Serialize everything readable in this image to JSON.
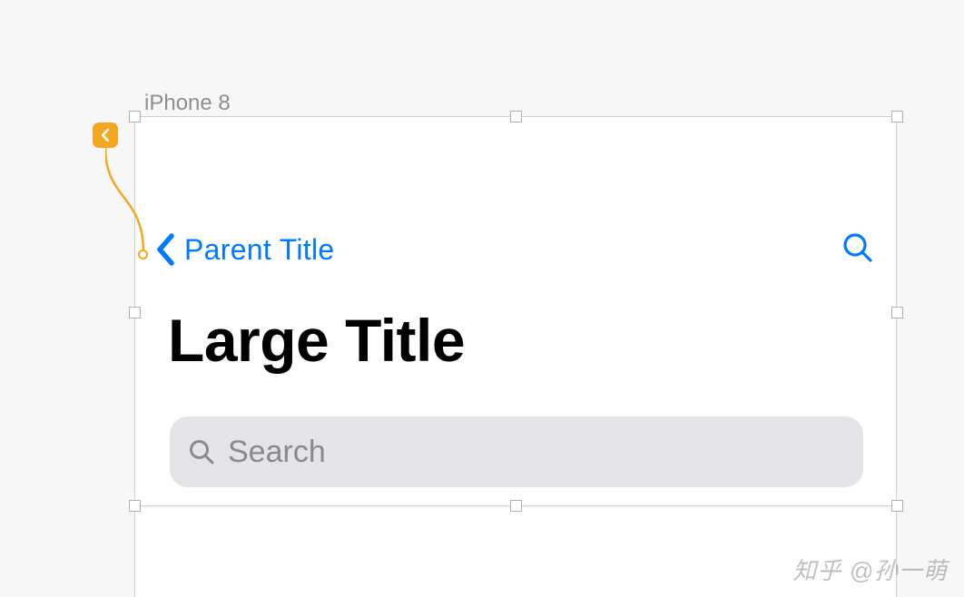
{
  "device": {
    "label": "iPhone 8"
  },
  "navbar": {
    "back_label": "Parent Title"
  },
  "title": {
    "large": "Large Title"
  },
  "search": {
    "placeholder": "Search"
  },
  "watermark": {
    "text": "知乎 @孙一萌"
  }
}
